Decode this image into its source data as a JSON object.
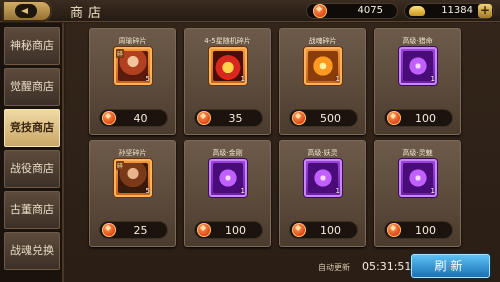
{
  "header": {
    "title": "商店",
    "currency_coin": "4075",
    "currency_ingot": "11384",
    "plus_label": "+"
  },
  "sidebar": {
    "items": [
      {
        "label": "神秘商店",
        "active": false
      },
      {
        "label": "觉醒商店",
        "active": false
      },
      {
        "label": "竞技商店",
        "active": true
      },
      {
        "label": "战役商店",
        "active": false
      },
      {
        "label": "古董商店",
        "active": false
      },
      {
        "label": "战魂兑换",
        "active": false
      }
    ]
  },
  "shop": {
    "items": [
      {
        "name": "周瑜碎片",
        "price": "40",
        "count": "5",
        "frame": "orange",
        "icon": "hero-portrait-icon"
      },
      {
        "name": "4-5星随机碎片",
        "price": "35",
        "count": "1",
        "frame": "orange",
        "icon": "random-shard-icon"
      },
      {
        "name": "战魂碎片",
        "price": "500",
        "count": "1",
        "frame": "orange",
        "icon": "war-soul-icon"
      },
      {
        "name": "高级·猎命",
        "price": "100",
        "count": "1",
        "frame": "purple",
        "icon": "purple-rune-icon"
      },
      {
        "name": "孙坚碎片",
        "price": "25",
        "count": "5",
        "frame": "orange",
        "icon": "hero-portrait-icon"
      },
      {
        "name": "高级·金刚",
        "price": "100",
        "count": "1",
        "frame": "purple",
        "icon": "purple-rune-icon"
      },
      {
        "name": "高级·妖灵",
        "price": "100",
        "count": "1",
        "frame": "purple",
        "icon": "purple-rune-icon"
      },
      {
        "name": "高级·灵魅",
        "price": "100",
        "count": "1",
        "frame": "purple",
        "icon": "purple-rune-icon"
      }
    ]
  },
  "footer": {
    "auto_refresh_label": "自动更新",
    "timer": "05:31:51",
    "refresh_label": "刷新"
  }
}
